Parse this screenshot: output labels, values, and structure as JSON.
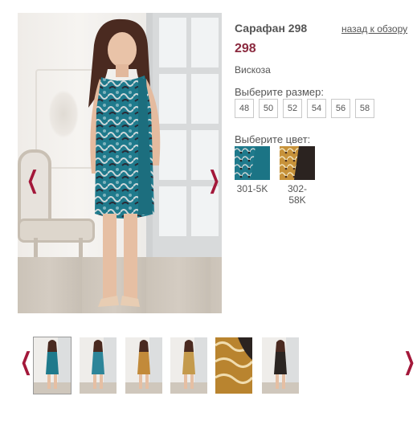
{
  "product": {
    "title": "Сарафан 298",
    "back_link": "назад к обзору",
    "price": "298",
    "material": "Вискоза"
  },
  "size_selector": {
    "label": "Выберите размер:",
    "sizes": [
      "48",
      "50",
      "52",
      "54",
      "56",
      "58"
    ]
  },
  "color_selector": {
    "label": "Выберите цвет:",
    "colors": [
      {
        "code": "301-5K",
        "primary": "#1f7a8c",
        "secondary": "#2a2a35"
      },
      {
        "code": "302-\n58K",
        "primary": "#c7923a",
        "secondary": "#2b2320"
      }
    ]
  },
  "gallery": {
    "prev_arrow": "❮",
    "next_arrow": "❯",
    "thumb_prev_arrow": "❮",
    "thumb_next_arrow": "❯",
    "thumbnails": [
      {
        "dress": "#1f7a8c",
        "selected": true
      },
      {
        "dress": "#2d8599",
        "selected": false
      },
      {
        "dress": "#c28a3a",
        "selected": false
      },
      {
        "dress": "#c49a4c",
        "selected": false
      },
      {
        "dress": "#b9842f",
        "selected": false
      },
      {
        "dress": "#2b2522",
        "selected": false
      }
    ]
  },
  "colors": {
    "accent": "#a3183a",
    "price": "#8b2a3f",
    "dress_teal": "#1f7a8c"
  }
}
